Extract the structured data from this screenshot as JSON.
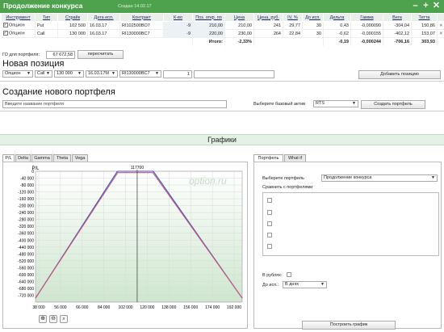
{
  "window": {
    "title": "Продолжение конкурса",
    "subtitle": "Создан 14.02.17"
  },
  "positions": {
    "headers": [
      "Инструмент",
      "Тип",
      "Страйк",
      "Дата исп.",
      "Контракт",
      "К-во",
      "Поз. откр. по",
      "Цена",
      "Цена, руб.",
      "IV, %",
      "До исп.",
      "Дельта",
      "Гамма",
      "Вега",
      "Тетта"
    ],
    "rows": [
      [
        "Опцион",
        "Put",
        "102 500",
        "16.03.17",
        "RI102500BO7",
        "-9",
        "210,00",
        "210,00",
        "241",
        "29,77",
        "30",
        "0,43",
        "-0,000090",
        "-304,04",
        "150,86"
      ],
      [
        "Опцион",
        "Call",
        "130 000",
        "16.03.17",
        "RI130000BC7",
        "-9",
        "220,00",
        "230,00",
        "264",
        "22,84",
        "30",
        "-0,62",
        "-0,000155",
        "-402,12",
        "153,07"
      ]
    ],
    "total_label": "Итого:",
    "total_values": [
      "-2,33%",
      "-0,19",
      "-0,000244",
      "-706,16",
      "303,93"
    ]
  },
  "go": {
    "label": "ГО для портфеля:",
    "value": "67 672,58",
    "recalc": "пересчитать"
  },
  "new_position": {
    "heading": "Новая позиция",
    "instrument": "Опцион",
    "type": "Call",
    "strike": "130 000",
    "date": "16.03.17M",
    "contract": "RI130000BC7",
    "qty": "1",
    "add_button": "Добавить позицию"
  },
  "new_portfolio": {
    "heading": "Создание нового портфеля",
    "name_placeholder": "Введите название портфеля",
    "base_label": "Выберите базовый актив",
    "base_value": "RTS",
    "create_button": "Создать портфель"
  },
  "graphs": {
    "heading": "Графики",
    "tabs": [
      "P/L",
      "Delta",
      "Gamma",
      "Theta",
      "Vega"
    ],
    "watermark": "option.ru",
    "right_tabs": [
      "Портфель",
      "What if"
    ],
    "portfolio_label": "Выберите портфель",
    "portfolio_value": "Продолжение конкурса",
    "compare_label": "Сравнить с портфелями",
    "rub_label": "В рублях:",
    "until_label": "До исп.:",
    "until_value": "В днях",
    "build_button": "Построить график"
  },
  "chart_data": {
    "type": "line",
    "ylabel": "P/L",
    "marker_label": "117700",
    "x": [
      38000,
      102000,
      102500,
      130000,
      130500,
      200000
    ],
    "series": [
      {
        "color": "#3355cc",
        "values": [
          -737000,
          -2000,
          0,
          0,
          -2000,
          -737000
        ]
      },
      {
        "color": "#cc5577",
        "values": [
          -737000,
          -13000,
          -8000,
          -8000,
          -13000,
          -737000
        ]
      }
    ],
    "xlim": [
      38000,
      200000
    ],
    "ylim": [
      -760000,
      0
    ],
    "xticks": [
      "38 000",
      "56 000",
      "66 000",
      "84 000",
      "102 000",
      "120 000",
      "138 000",
      "156 000",
      "174 000",
      "192 000"
    ],
    "yticks": [
      "0",
      "-40 000",
      "-80 000",
      "-120 000",
      "-160 000",
      "-200 000",
      "-240 000",
      "-280 000",
      "-320 000",
      "-360 000",
      "-400 000",
      "-440 000",
      "-480 000",
      "-520 000",
      "-560 000",
      "-600 000",
      "-640 000",
      "-680 000",
      "-720 000"
    ]
  }
}
